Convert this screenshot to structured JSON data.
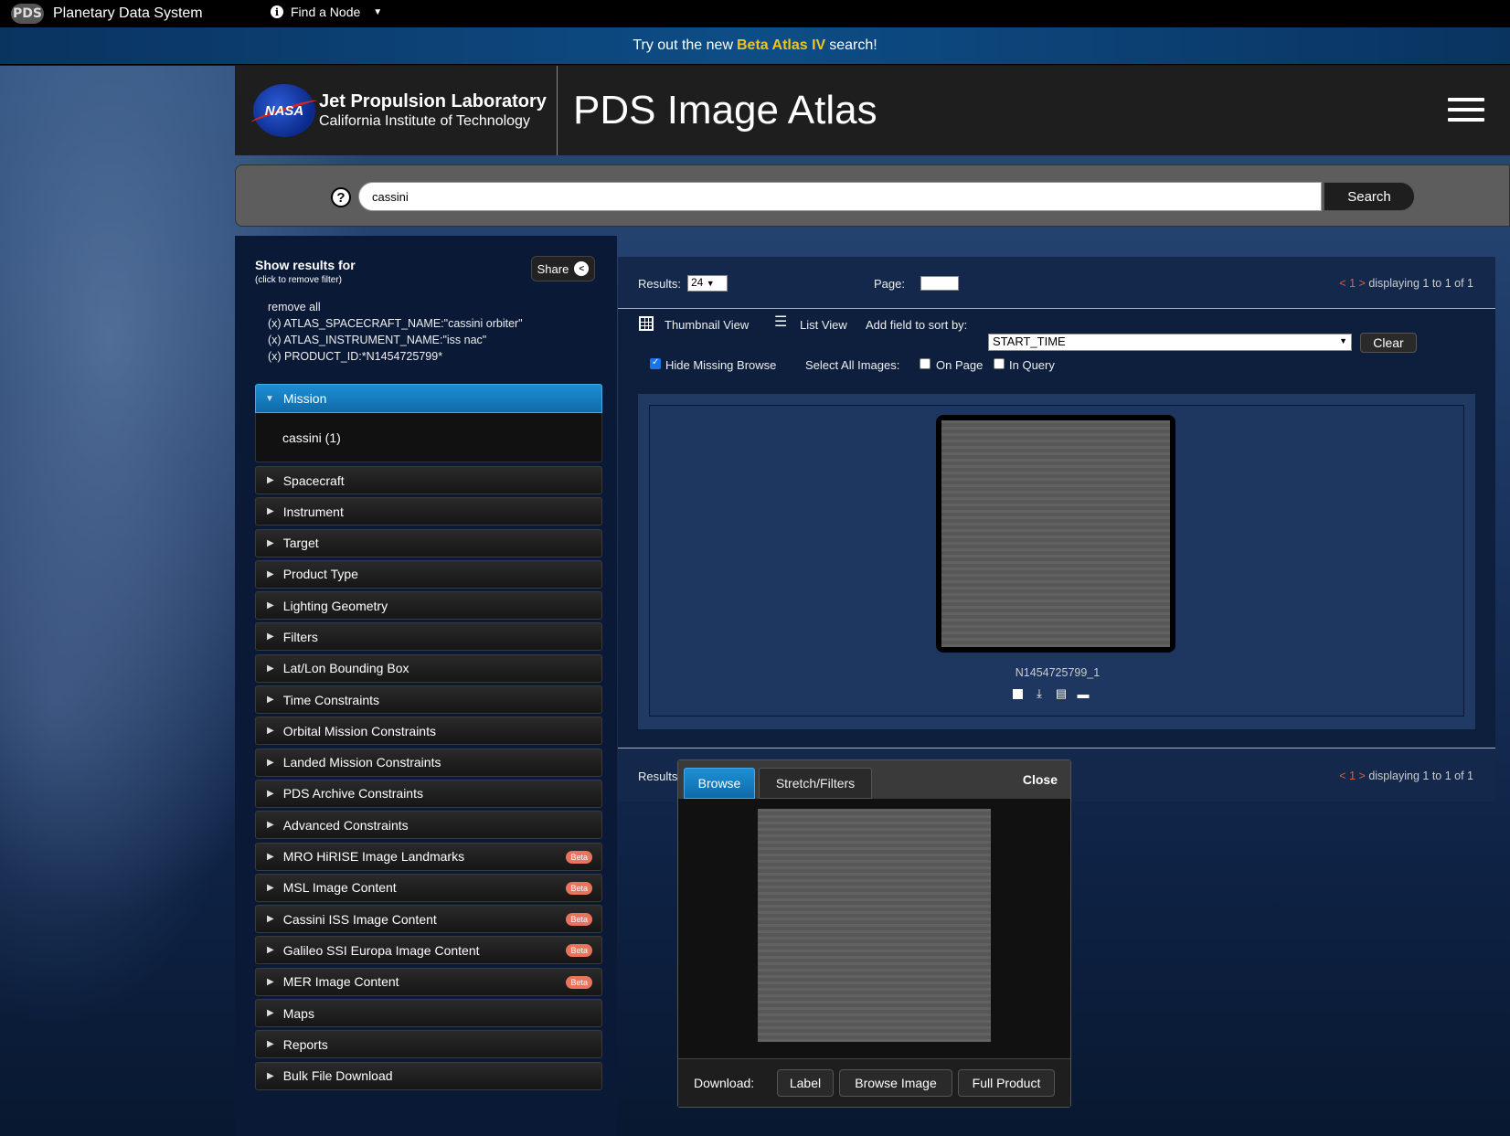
{
  "topnav": {
    "logo": "PDS",
    "site_name": "Planetary Data System",
    "find_node": "Find a Node"
  },
  "banner": {
    "prefix": "Try out the new",
    "highlight": "Beta Atlas IV",
    "suffix": "search!"
  },
  "header": {
    "nasa_logo": "NASA",
    "org_line1": "Jet Propulsion Laboratory",
    "org_line2": "California Institute of Technology",
    "title": "PDS Image Atlas"
  },
  "search": {
    "help": "?",
    "query": "cassini",
    "button": "Search"
  },
  "sidebar": {
    "heading": "Show results for",
    "subheading": "(click to remove filter)",
    "share": "Share",
    "filters": [
      "remove all",
      "(x) ATLAS_SPACECRAFT_NAME:\"cassini orbiter\"",
      "(x) ATLAS_INSTRUMENT_NAME:\"iss nac\"",
      "(x) PRODUCT_ID:*N1454725799*"
    ],
    "open_facet": {
      "label": "Mission",
      "value": "cassini (1)"
    },
    "facets": [
      {
        "label": "Spacecraft",
        "beta": ""
      },
      {
        "label": "Instrument",
        "beta": ""
      },
      {
        "label": "Target",
        "beta": ""
      },
      {
        "label": "Product Type",
        "beta": ""
      },
      {
        "label": "Lighting Geometry",
        "beta": ""
      },
      {
        "label": "Filters",
        "beta": ""
      },
      {
        "label": "Lat/Lon Bounding Box",
        "beta": ""
      },
      {
        "label": "Time Constraints",
        "beta": ""
      },
      {
        "label": "Orbital Mission Constraints",
        "beta": ""
      },
      {
        "label": "Landed Mission Constraints",
        "beta": ""
      },
      {
        "label": "PDS Archive Constraints",
        "beta": ""
      },
      {
        "label": "Advanced Constraints",
        "beta": ""
      },
      {
        "label": "MRO HiRISE Image Landmarks",
        "beta": "Beta"
      },
      {
        "label": "MSL Image Content",
        "beta": "Beta"
      },
      {
        "label": "Cassini ISS Image Content",
        "beta": "Beta"
      },
      {
        "label": "Galileo SSI Europa Image Content",
        "beta": "Beta"
      },
      {
        "label": "MER Image Content",
        "beta": "Beta"
      },
      {
        "label": "Maps",
        "beta": ""
      },
      {
        "label": "Reports",
        "beta": ""
      },
      {
        "label": "Bulk File Download",
        "beta": ""
      }
    ]
  },
  "results": {
    "results_label": "Results:",
    "results_per_page": "24",
    "page_label": "Page:",
    "pager_prev": "<",
    "pager_page": "1",
    "pager_next": ">",
    "displaying": "displaying 1 to 1 of 1",
    "thumbnail_view": "Thumbnail View",
    "list_view": "List View",
    "sort_label": "Add field to sort by:",
    "sort_value": "START_TIME",
    "clear": "Clear",
    "hide_missing": "Hide Missing Browse",
    "select_all": "Select All Images:",
    "on_page": "On Page",
    "in_query": "In Query",
    "item_id": "N1454725799_1",
    "bottom_results_label": "Results"
  },
  "popup": {
    "tab_browse": "Browse",
    "tab_stretch": "Stretch/Filters",
    "close": "Close",
    "download_label": "Download:",
    "btn_label": "Label",
    "btn_browse": "Browse Image",
    "btn_full": "Full Product"
  }
}
